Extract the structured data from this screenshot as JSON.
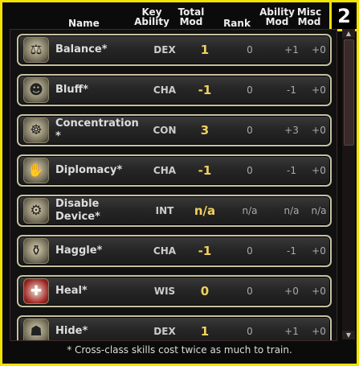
{
  "badge": "2",
  "headers": {
    "name": "Name",
    "key_ability": [
      "Key",
      "Ability"
    ],
    "total_mod": [
      "Total",
      "Mod"
    ],
    "rank": "Rank",
    "ability_mod": [
      "Ability",
      "Mod"
    ],
    "misc_mod": [
      "Misc",
      "Mod"
    ]
  },
  "skills": [
    {
      "name": "Balance*",
      "name2": "",
      "ability": "DEX",
      "total": "1",
      "rank": "0",
      "ability_mod": "+1",
      "misc_mod": "+0",
      "icon": "balance-icon",
      "glyph": "⚖"
    },
    {
      "name": "Bluff*",
      "name2": "",
      "ability": "CHA",
      "total": "-1",
      "rank": "0",
      "ability_mod": "-1",
      "misc_mod": "+0",
      "icon": "bluff-icon",
      "glyph": "☻"
    },
    {
      "name": "Concentration",
      "name2": "*",
      "ability": "CON",
      "total": "3",
      "rank": "0",
      "ability_mod": "+3",
      "misc_mod": "+0",
      "icon": "concentration-icon",
      "glyph": "☸"
    },
    {
      "name": "Diplomacy*",
      "name2": "",
      "ability": "CHA",
      "total": "-1",
      "rank": "0",
      "ability_mod": "-1",
      "misc_mod": "+0",
      "icon": "diplomacy-icon",
      "glyph": "✋"
    },
    {
      "name": "Disable",
      "name2": "Device*",
      "ability": "INT",
      "total": "n/a",
      "rank": "n/a",
      "ability_mod": "n/a",
      "misc_mod": "n/a",
      "icon": "disable-device-icon",
      "glyph": "⚙"
    },
    {
      "name": "Haggle*",
      "name2": "",
      "ability": "CHA",
      "total": "-1",
      "rank": "0",
      "ability_mod": "-1",
      "misc_mod": "+0",
      "icon": "haggle-icon",
      "glyph": "⚱"
    },
    {
      "name": "Heal*",
      "name2": "",
      "ability": "WIS",
      "total": "0",
      "rank": "0",
      "ability_mod": "+0",
      "misc_mod": "+0",
      "icon": "heal-icon",
      "glyph": "✚"
    },
    {
      "name": "Hide*",
      "name2": "",
      "ability": "DEX",
      "total": "1",
      "rank": "0",
      "ability_mod": "+1",
      "misc_mod": "+0",
      "icon": "hide-icon",
      "glyph": "☗"
    }
  ],
  "footer": "* Cross-class skills cost twice as much to train.",
  "scroll": {
    "up": "▲",
    "down": "▼"
  }
}
